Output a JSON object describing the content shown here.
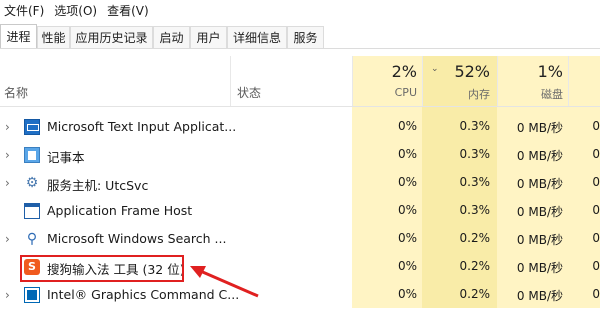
{
  "menu": [
    "文件(F)",
    "选项(O)",
    "查看(V)"
  ],
  "tabs": [
    "进程",
    "性能",
    "应用历史记录",
    "启动",
    "用户",
    "详细信息",
    "服务"
  ],
  "header": {
    "name": "名称",
    "status": "状态",
    "cpu_pct": "2%",
    "cpu_label": "CPU",
    "mem_pct": "52%",
    "mem_label": "内存",
    "disk_pct": "1%",
    "disk_label": "磁盘",
    "sort_glyph": "⌄"
  },
  "rows": [
    {
      "chevron": "›",
      "name": "Microsoft Text Input Applicat...",
      "icon": "text-input-icon",
      "cpu": "0%",
      "mem": "0.3%",
      "disk": "0 MB/秒",
      "net": "0"
    },
    {
      "chevron": "›",
      "name": "记事本",
      "icon": "notepad-icon",
      "cpu": "0%",
      "mem": "0.3%",
      "disk": "0 MB/秒",
      "net": "0"
    },
    {
      "chevron": "›",
      "name": "服务主机: UtcSvc",
      "icon": "gear-icon",
      "cpu": "0%",
      "mem": "0.3%",
      "disk": "0 MB/秒",
      "net": "0"
    },
    {
      "chevron": "",
      "name": "Application Frame Host",
      "icon": "window-icon",
      "cpu": "0%",
      "mem": "0.3%",
      "disk": "0 MB/秒",
      "net": "0"
    },
    {
      "chevron": "›",
      "name": "Microsoft Windows Search ...",
      "icon": "search-user-icon",
      "cpu": "0%",
      "mem": "0.2%",
      "disk": "0 MB/秒",
      "net": "0"
    },
    {
      "chevron": "",
      "name": "搜狗输入法 工具 (32 位)",
      "icon": "sogou-icon",
      "sogou_glyph": "S",
      "cpu": "0%",
      "mem": "0.2%",
      "disk": "0 MB/秒",
      "net": "0"
    },
    {
      "chevron": "›",
      "name": "Intel® Graphics Command C...",
      "icon": "intel-icon",
      "cpu": "0%",
      "mem": "0.2%",
      "disk": "0 MB/秒",
      "net": "0"
    }
  ],
  "colors": {
    "cpu_col": "#fff4c4",
    "mem_col": "#f9eca8",
    "disk_col": "#fff4c4",
    "annotation": "#e02020"
  }
}
